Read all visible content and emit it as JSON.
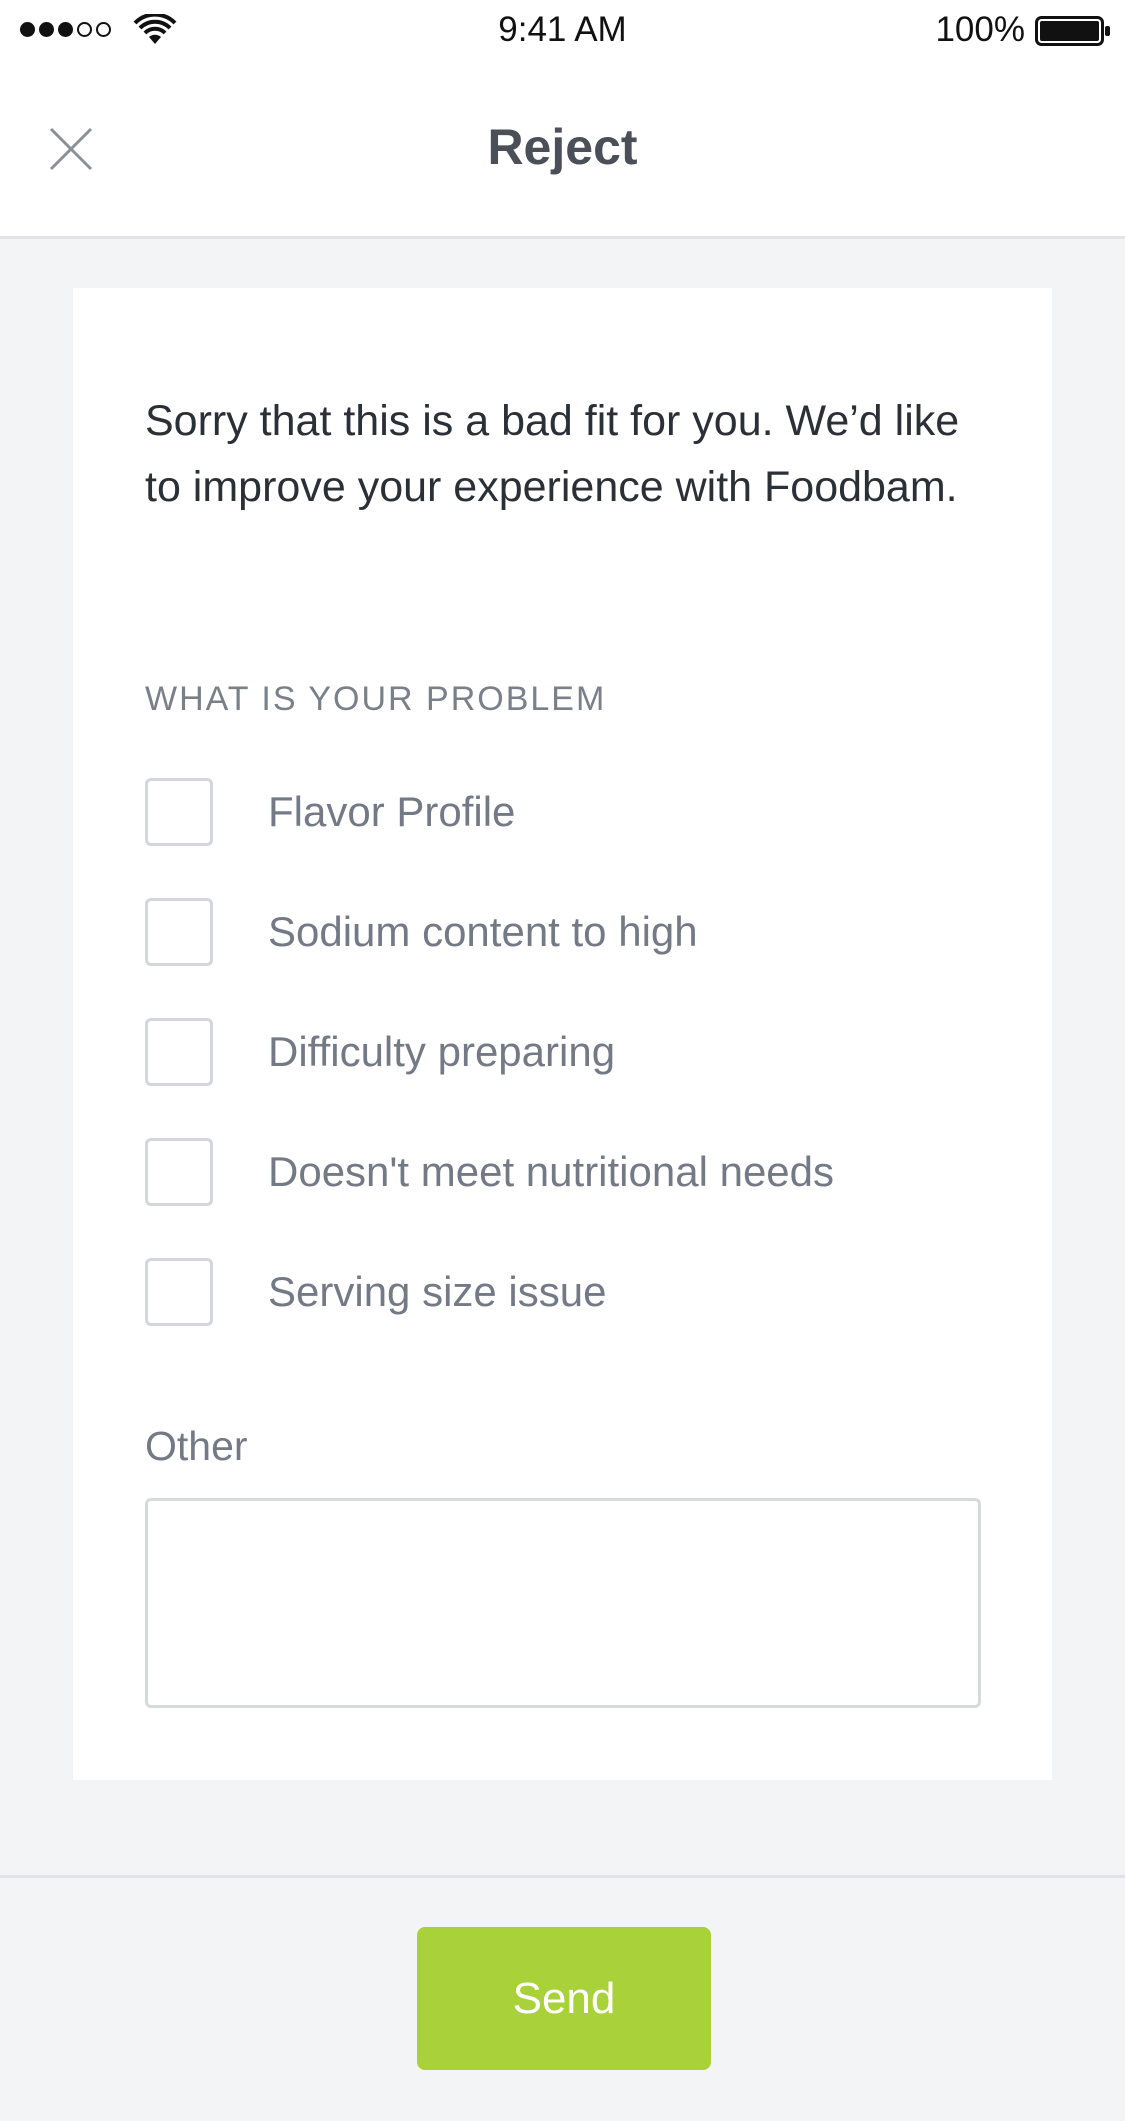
{
  "status_bar": {
    "signal_icon": "cellular-signal-icon",
    "wifi_icon": "wifi-icon",
    "time": "9:41 AM",
    "battery_percent": "100%",
    "battery_icon": "battery-full-icon"
  },
  "header": {
    "close_icon": "close-icon",
    "title": "Reject"
  },
  "form": {
    "intro": "Sorry that this is a bad fit for you. We’d like to improve your experience with Foodbam.",
    "section_label": "WHAT IS YOUR PROBLEM",
    "options": [
      {
        "label": "Flavor Profile",
        "checked": false
      },
      {
        "label": "Sodium content to high",
        "checked": false
      },
      {
        "label": "Difficulty preparing",
        "checked": false
      },
      {
        "label": "Doesn't meet nutritional needs",
        "checked": false
      },
      {
        "label": "Serving size issue",
        "checked": false
      }
    ],
    "other_label": "Other",
    "other_value": ""
  },
  "footer": {
    "send_label": "Send"
  },
  "colors": {
    "accent": "#a8d13a",
    "background": "#f3f4f6",
    "title_text": "#4a4f58",
    "muted_text": "#737985"
  }
}
